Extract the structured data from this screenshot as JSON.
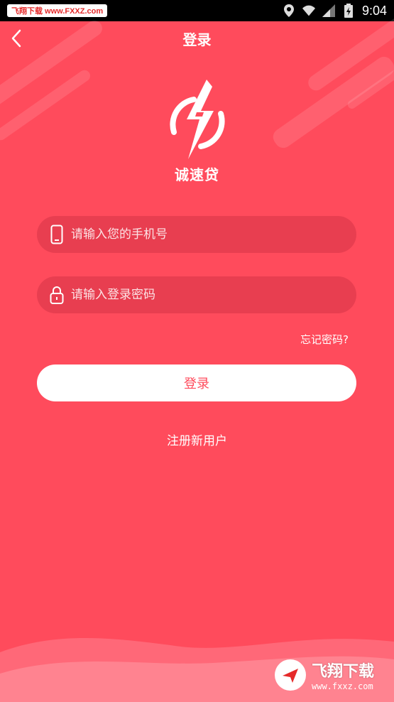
{
  "status_bar": {
    "watermark_text": "飞翔下载 www.FXXZ.com",
    "time": "9:04"
  },
  "app_bar": {
    "title": "登录"
  },
  "brand": {
    "name": "诚速贷"
  },
  "form": {
    "phone_placeholder": "请输入您的手机号",
    "password_placeholder": "请输入登录密码",
    "forgot_label": "忘记密码?",
    "login_label": "登录",
    "register_label": "注册新用户"
  },
  "watermark_bottom": {
    "title": "飞翔下载",
    "url": "www.fxxz.com"
  },
  "colors": {
    "background": "#ff4b5c",
    "button_bg": "#ffffff",
    "button_text": "#ff4b5c"
  }
}
